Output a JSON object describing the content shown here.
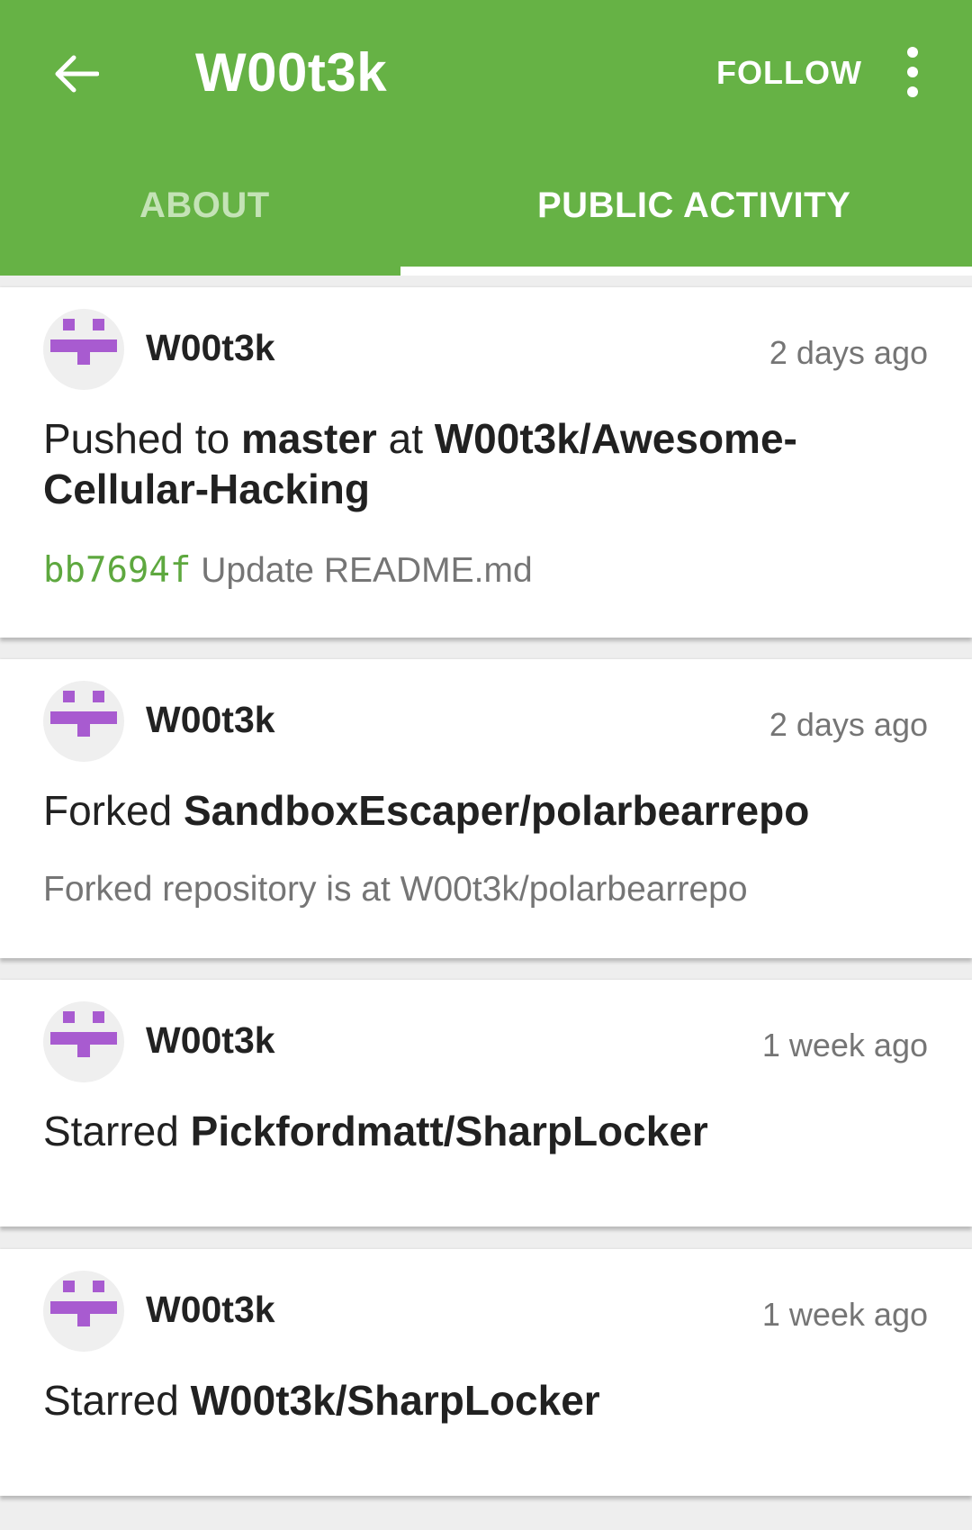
{
  "appbar": {
    "title": "W00t3k",
    "follow_label": "FOLLOW",
    "back_icon": "arrow-left-icon",
    "more_icon": "more-vert-icon",
    "background_color": "#66b245"
  },
  "tabs": [
    {
      "label": "ABOUT",
      "selected": false
    },
    {
      "label": "PUBLIC ACTIVITY",
      "selected": true
    }
  ],
  "events": [
    {
      "user": "W00t3k",
      "time": "2 days ago",
      "action": "Pushed to",
      "ref": "master",
      "connector": "at",
      "target": "W00t3k/Awesome-Cellular-Hacking",
      "sha": "bb7694f",
      "detail": "Update README.md"
    },
    {
      "user": "W00t3k",
      "time": "2 days ago",
      "action": "Forked",
      "target": "SandboxEscaper/polarbearrepo",
      "detail": "Forked repository is at W00t3k/polarbearrepo"
    },
    {
      "user": "W00t3k",
      "time": "1 week ago",
      "action": "Starred",
      "target": "Pickfordmatt/SharpLocker"
    },
    {
      "user": "W00t3k",
      "time": "1 week ago",
      "action": "Starred",
      "target": "W00t3k/SharpLocker"
    }
  ],
  "colors": {
    "accent": "#66b245",
    "sha": "#5ea83f",
    "identicon": "#a85bd0"
  }
}
